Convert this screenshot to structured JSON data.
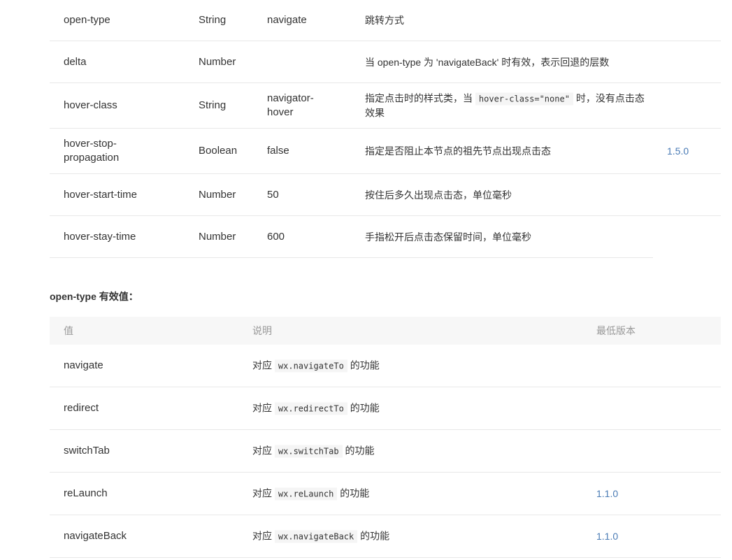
{
  "attributes": [
    {
      "name": "open-type",
      "type": "String",
      "default": "navigate",
      "desc_parts": [
        "跳转方式"
      ],
      "version": ""
    },
    {
      "name": "delta",
      "type": "Number",
      "default": "",
      "desc_parts": [
        "当 open-type 为 'navigateBack' 时有效，表示回退的层数"
      ],
      "version": ""
    },
    {
      "name": "hover-class",
      "type": "String",
      "default": "navigator-hover",
      "desc_parts": [
        "指定点击时的样式类，当 ",
        "hover-class=\"none\"",
        " 时，没有点击态效果"
      ],
      "version": ""
    },
    {
      "name": "hover-stop-propagation",
      "type": "Boolean",
      "default": "false",
      "desc_parts": [
        "指定是否阻止本节点的祖先节点出现点击态"
      ],
      "version": "1.5.0"
    },
    {
      "name": "hover-start-time",
      "type": "Number",
      "default": "50",
      "desc_parts": [
        "按住后多久出现点击态，单位毫秒"
      ],
      "version": ""
    },
    {
      "name": "hover-stay-time",
      "type": "Number",
      "default": "600",
      "desc_parts": [
        "手指松开后点击态保留时间，单位毫秒"
      ],
      "version": ""
    }
  ],
  "open_type_section": {
    "heading": "open-type 有效值：",
    "headers": {
      "value": "值",
      "desc": "说明",
      "version": "最低版本"
    },
    "rows": [
      {
        "value": "navigate",
        "desc_prefix": "对应 ",
        "api": "wx.navigateTo",
        "desc_suffix": " 的功能",
        "version": ""
      },
      {
        "value": "redirect",
        "desc_prefix": "对应 ",
        "api": "wx.redirectTo",
        "desc_suffix": " 的功能",
        "version": ""
      },
      {
        "value": "switchTab",
        "desc_prefix": "对应 ",
        "api": "wx.switchTab",
        "desc_suffix": " 的功能",
        "version": ""
      },
      {
        "value": "reLaunch",
        "desc_prefix": "对应 ",
        "api": "wx.reLaunch",
        "desc_suffix": " 的功能",
        "version": "1.1.0"
      },
      {
        "value": "navigateBack",
        "desc_prefix": "对应 ",
        "api": "wx.navigateBack",
        "desc_suffix": " 的功能",
        "version": "1.1.0"
      }
    ]
  }
}
